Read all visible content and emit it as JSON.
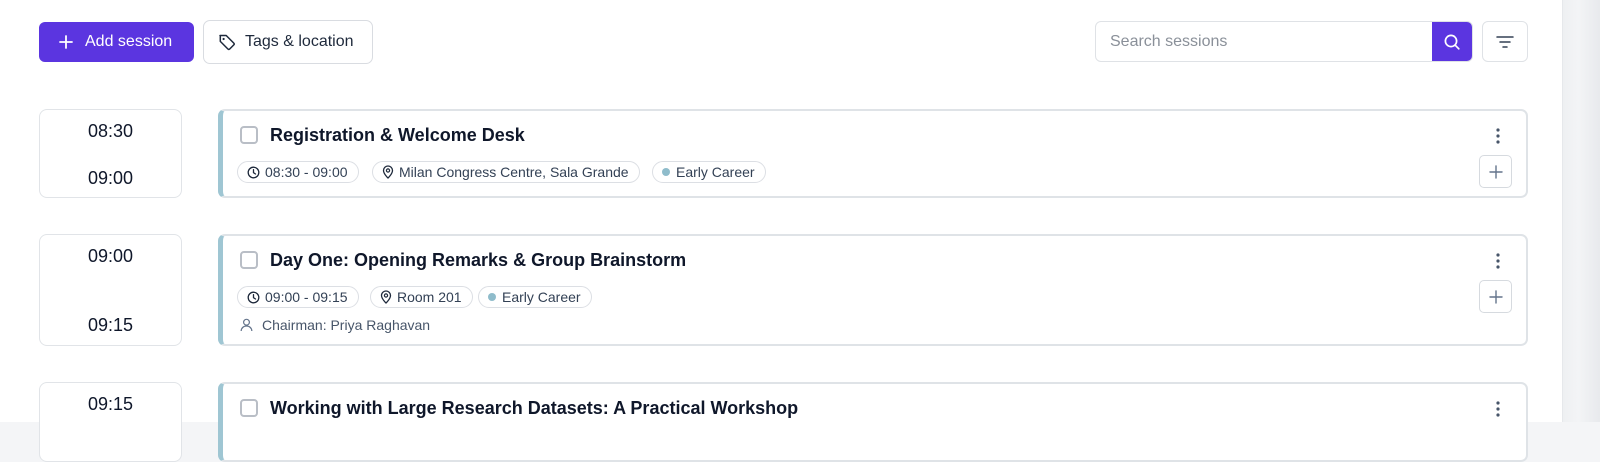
{
  "toolbar": {
    "add_session_label": "Add session",
    "tags_location_label": "Tags & location",
    "search_placeholder": "Search sessions",
    "search_value": ""
  },
  "colors": {
    "primary": "#5b35e0",
    "card_accent": "#9fc6d3",
    "tag_dot": "#8fbccb"
  },
  "sessions": [
    {
      "start": "08:30",
      "end": "09:00",
      "title": "Registration & Welcome Desk",
      "time_range": "08:30 - 09:00",
      "location": "Milan Congress Centre, Sala Grande",
      "tag": "Early Career",
      "chairman": ""
    },
    {
      "start": "09:00",
      "end": "09:15",
      "title": "Day One: Opening Remarks & Group Brainstorm",
      "time_range": "09:00 - 09:15",
      "location": "Room 201",
      "tag": "Early Career",
      "chairman": "Chairman: Priya Raghavan"
    },
    {
      "start": "09:15",
      "title": "Working with Large Research Datasets: A Practical Workshop"
    }
  ]
}
